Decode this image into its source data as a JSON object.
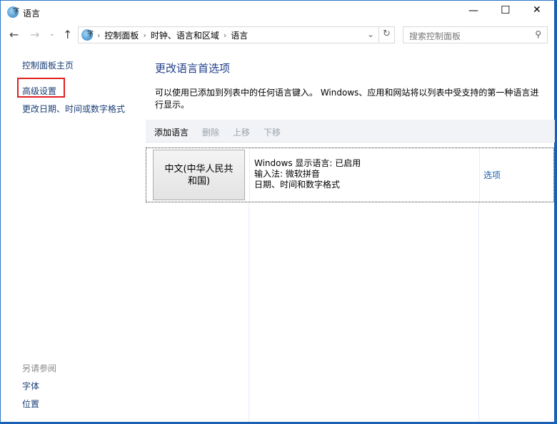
{
  "window": {
    "title": "语言",
    "minimize": "—",
    "maximize": "☐",
    "close": "✕"
  },
  "address": {
    "crumbs": [
      "控制面板",
      "时钟、语言和区域",
      "语言"
    ],
    "search_placeholder": "搜索控制面板"
  },
  "sidebar": {
    "home": "控制面板主页",
    "advanced": "高级设置",
    "date_format": "更改日期、时间或数字格式",
    "see_also": "另请参阅",
    "fonts": "字体",
    "location": "位置"
  },
  "main": {
    "title": "更改语言首选项",
    "description_line1": "可以使用已添加到列表中的任何语言键入。 Windows、应用和网站将以列表中受支持的第一种语言进",
    "description_line2": "行显示。",
    "toolbar": {
      "add": "添加语言",
      "remove": "删除",
      "up": "上移",
      "down": "下移"
    },
    "languages": [
      {
        "name_line1": "中文(中华人民共",
        "name_line2": "和国)",
        "display": "Windows 显示语言: 已启用",
        "ime": "输入法: 微软拼音",
        "format": "日期、时间和数字格式",
        "options": "选项"
      }
    ]
  },
  "colors": {
    "accent": "#1d5fa8",
    "highlight_box": "#e02020",
    "window_border": "#1a5fb4"
  }
}
